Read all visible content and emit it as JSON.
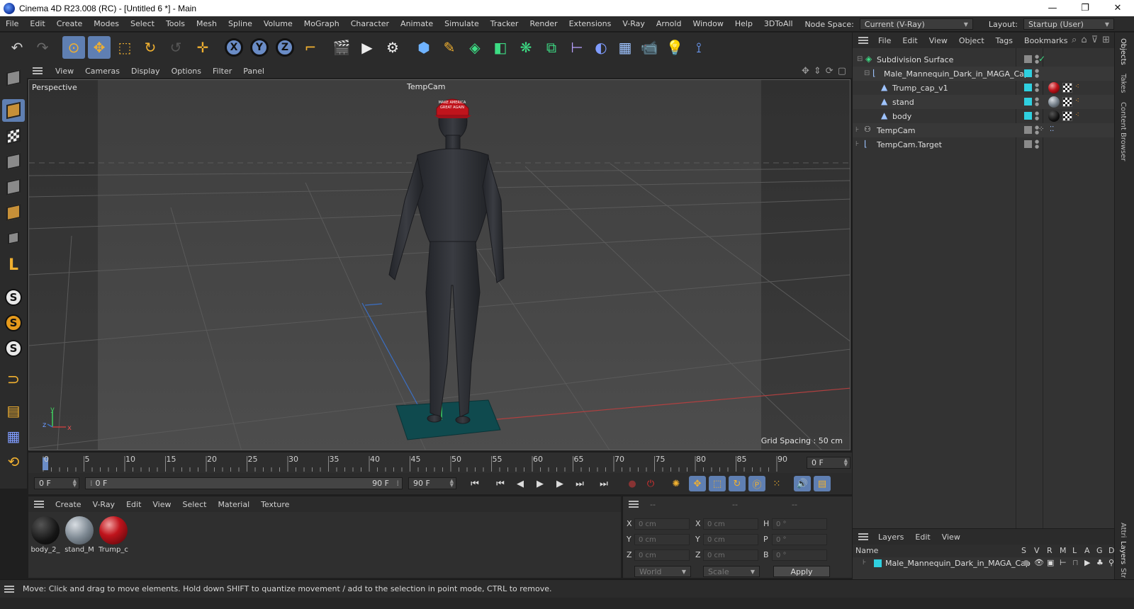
{
  "window": {
    "title": "Cinema 4D R23.008 (RC) - [Untitled 6 *] - Main",
    "minimize": "—",
    "restore": "❐",
    "close": "✕"
  },
  "menubar": {
    "items": [
      "File",
      "Edit",
      "Create",
      "Modes",
      "Select",
      "Tools",
      "Mesh",
      "Spline",
      "Volume",
      "MoGraph",
      "Character",
      "Animate",
      "Simulate",
      "Tracker",
      "Render",
      "Extensions",
      "V-Ray",
      "Arnold",
      "Window",
      "Help",
      "3DToAll"
    ],
    "node_space_label": "Node Space:",
    "node_space_value": "Current (V-Ray)",
    "layout_label": "Layout:",
    "layout_value": "Startup (User)"
  },
  "toolbar": {
    "axis_x": "X",
    "axis_y": "Y",
    "axis_z": "Z"
  },
  "left_tools": {
    "s1": "S",
    "s2": "S",
    "s3": "S"
  },
  "viewport_menu": {
    "items": [
      "View",
      "Cameras",
      "Display",
      "Options",
      "Filter",
      "Panel"
    ]
  },
  "viewport": {
    "view_name": "Perspective",
    "camera_label": "TempCam",
    "grid_spacing": "Grid Spacing : 50 cm",
    "axis_y": "y",
    "axis_z": "z",
    "axis_x": "x",
    "cap_text_1": "MAKE AMERICA",
    "cap_text_2": "GREAT AGAIN"
  },
  "timeline": {
    "ticks": [
      "0",
      "5",
      "10",
      "15",
      "20",
      "25",
      "30",
      "35",
      "40",
      "45",
      "50",
      "55",
      "60",
      "65",
      "70",
      "75",
      "80",
      "85",
      "90"
    ],
    "current_frame": "0 F"
  },
  "transport": {
    "start_frame": "0 F",
    "range_start": "0 F",
    "range_end": "90 F",
    "end_frame": "90 F"
  },
  "material_panel": {
    "menu": [
      "Create",
      "V-Ray",
      "Edit",
      "View",
      "Select",
      "Material",
      "Texture"
    ],
    "materials": [
      {
        "name": "body_2_"
      },
      {
        "name": "stand_M"
      },
      {
        "name": "Trump_c"
      }
    ]
  },
  "attributes_panel": {
    "header_placeholders": [
      "--",
      "--",
      "--"
    ],
    "rows": [
      {
        "l1": "X",
        "v1": "0 cm",
        "l2": "X",
        "v2": "0 cm",
        "l3": "H",
        "v3": "0 °"
      },
      {
        "l1": "Y",
        "v1": "0 cm",
        "l2": "Y",
        "v2": "0 cm",
        "l3": "P",
        "v3": "0 °"
      },
      {
        "l1": "Z",
        "v1": "0 cm",
        "l2": "Z",
        "v2": "0 cm",
        "l3": "B",
        "v3": "0 °"
      }
    ],
    "coord_system": "World",
    "mode": "Scale",
    "apply_label": "Apply"
  },
  "objects_panel": {
    "menu": [
      "File",
      "Edit",
      "View",
      "Object",
      "Tags",
      "Bookmarks"
    ],
    "objects": [
      {
        "name": "Subdivision Surface"
      },
      {
        "name": "Male_Mannequin_Dark_in_MAGA_Cap"
      },
      {
        "name": "Trump_cap_v1"
      },
      {
        "name": "stand"
      },
      {
        "name": "body"
      },
      {
        "name": "TempCam"
      },
      {
        "name": "TempCam.Target"
      }
    ]
  },
  "layers_panel": {
    "menu": [
      "Layers",
      "Edit",
      "View"
    ],
    "columns": [
      "Name",
      "S",
      "V",
      "R",
      "M",
      "L",
      "A",
      "G",
      "D"
    ],
    "layer_name": "Male_Mannequin_Dark_in_MAGA_Cap"
  },
  "side_tabs": [
    "Objects",
    "Takes",
    "Content Browser",
    "Attributes",
    "Layers",
    "Structure"
  ],
  "status": {
    "message": "Move: Click and drag to move elements. Hold down SHIFT to quantize movement / add to the selection in point mode, CTRL to remove."
  },
  "colors": {
    "accent_active": "#5f7fb2",
    "layer_color": "#2fd0e0",
    "cap_red": "#c0141c",
    "stand_teal": "#0f4a4e",
    "mannequin": "#2c2e33"
  }
}
